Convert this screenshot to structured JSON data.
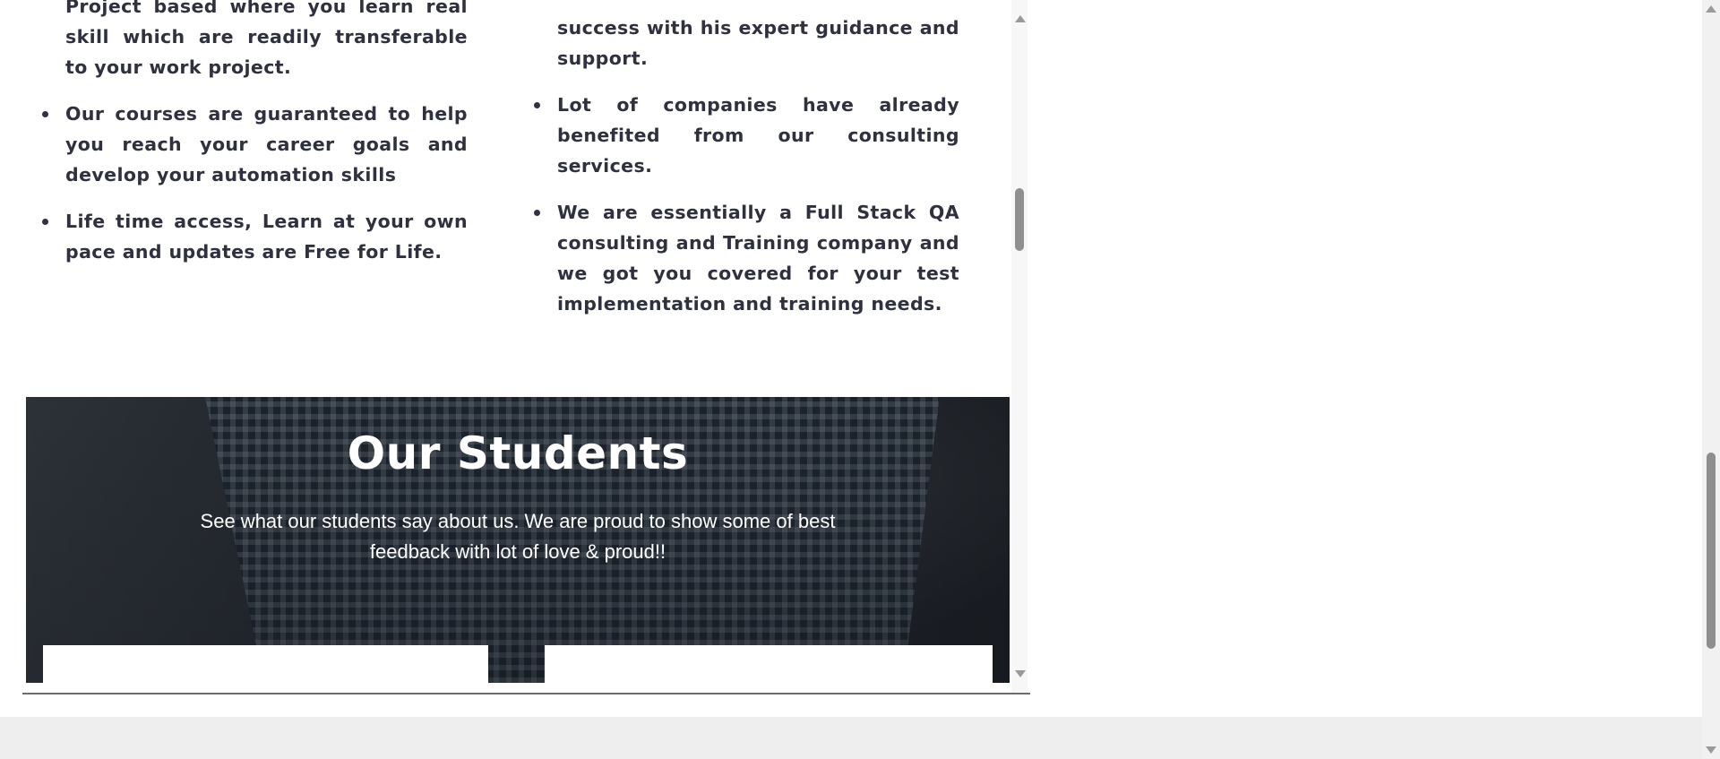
{
  "left_points": [
    "Project based where you learn real skill which are readily transferable to your work project.",
    "Our courses are guaranteed to help you reach your career goals and develop your automation skills",
    "Life time access, Learn at your own pace and updates are Free for Life."
  ],
  "right_points": [
    "success with his expert guidance and support.",
    "Lot of companies have already benefited from our consulting services.",
    "We are essentially a Full Stack QA consulting and Training company and we got you covered for your test implementation and training needs."
  ],
  "students": {
    "title": "Our Students",
    "subtitle": "See what our students say about us. We are proud to show some of best feedback with lot of love & proud!!"
  },
  "colors": {
    "text": "#2f3140",
    "section_overlay": "#1d2733",
    "background_band": "#eeeeee"
  }
}
